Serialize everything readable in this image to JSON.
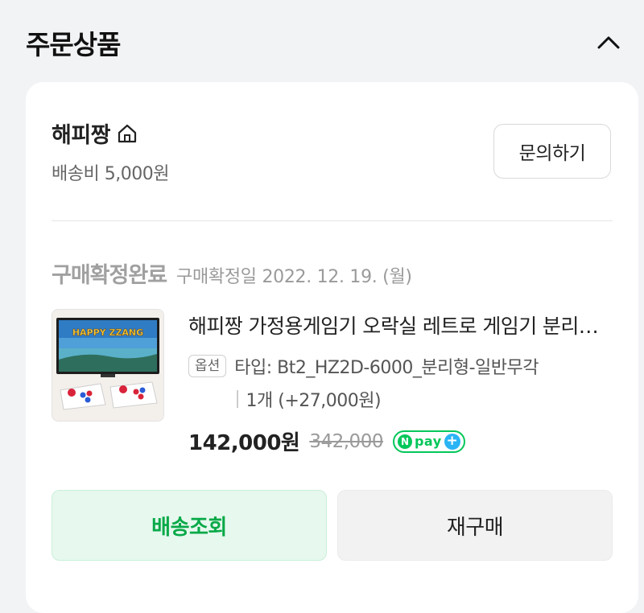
{
  "section": {
    "title": "주문상품"
  },
  "seller": {
    "name": "해피짱",
    "shipping_fee": "배송비 5,000원",
    "inquiry_label": "문의하기"
  },
  "order": {
    "status": "구매확정완료",
    "confirm_date": "구매확정일 2022. 12. 19. (월)"
  },
  "product": {
    "title": "해피짱 가정용게임기 오락실 레트로 게임기 분리형 조이스틱",
    "thumbnail_text": "HAPPY ZZANG",
    "option_badge": "옵션",
    "option_text": "타입: Bt2_HZ2D-6000_분리형-일반무각",
    "quantity_text": "1개 (+27,000원)",
    "price": "142,000원",
    "original_price": "342,000",
    "npay_label": "pay"
  },
  "actions": {
    "track_label": "배송조회",
    "reorder_label": "재구매"
  },
  "colors": {
    "accent_green": "#03c75a",
    "track_bg": "#e7f8ee",
    "npay_plus": "#2ab4f5"
  },
  "icons": {
    "collapse": "chevron-up-icon",
    "store": "home-icon"
  }
}
